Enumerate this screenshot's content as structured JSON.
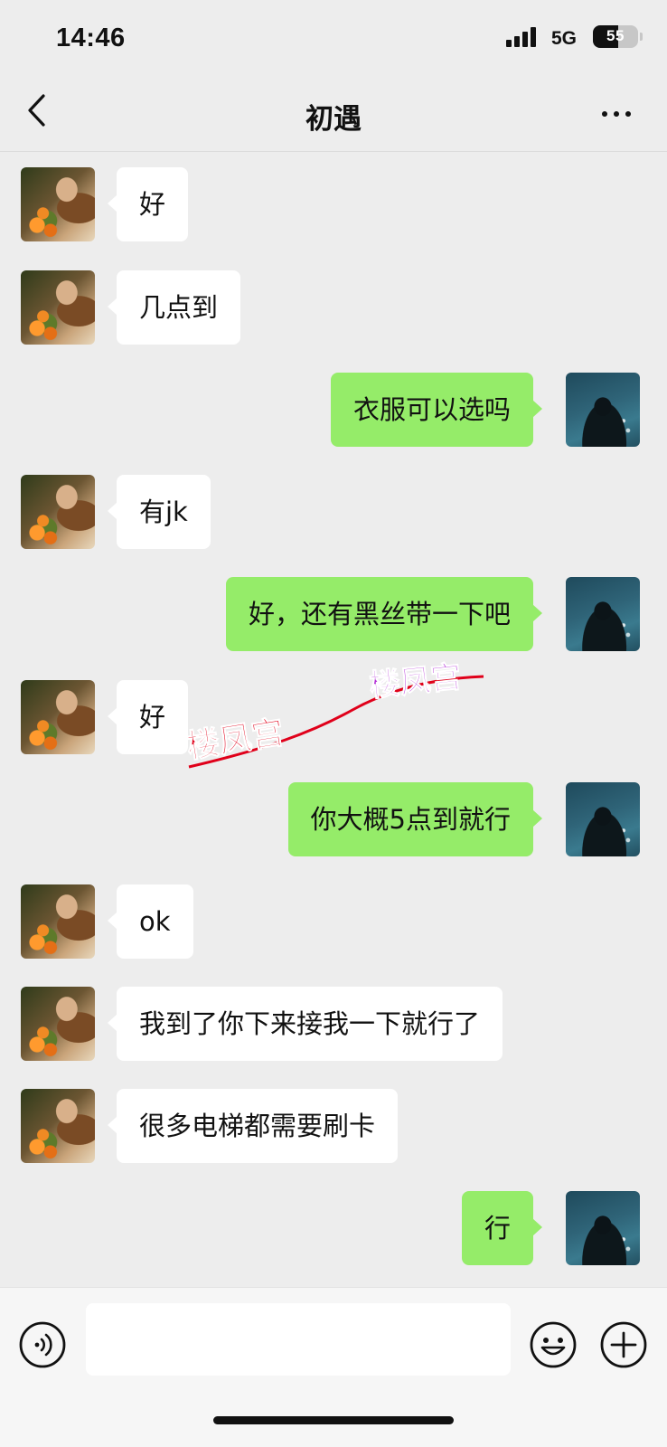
{
  "status_bar": {
    "time": "14:46",
    "network": "5G",
    "battery": "55"
  },
  "header": {
    "title": "初遇",
    "back_icon": "chevron-left-icon",
    "more_icon": "more-dots-icon"
  },
  "messages": [
    {
      "side": "left",
      "text": "好"
    },
    {
      "side": "left",
      "text": "几点到"
    },
    {
      "side": "right",
      "text": "衣服可以选吗"
    },
    {
      "side": "left",
      "text": "有jk"
    },
    {
      "side": "right",
      "text": "好，还有黑丝带一下吧"
    },
    {
      "side": "left",
      "text": "好"
    },
    {
      "side": "right",
      "text": "你大概5点到就行"
    },
    {
      "side": "left",
      "text": "ok"
    },
    {
      "side": "left",
      "text": "我到了你下来接我一下就行了"
    },
    {
      "side": "left",
      "text": "很多电梯都需要刷卡"
    },
    {
      "side": "right",
      "text": "行"
    }
  ],
  "watermark": {
    "text_1": "楼凤宫",
    "text_2": "楼凤宫",
    "color_1": "#e0001a",
    "color_2": "#b12ad6"
  },
  "input_bar": {
    "value": "",
    "voice_icon": "voice-icon",
    "emoji_icon": "emoji-icon",
    "plus_icon": "plus-icon"
  },
  "colors": {
    "background": "#ededed",
    "sent_bubble": "#95ec69",
    "received_bubble": "#ffffff"
  }
}
